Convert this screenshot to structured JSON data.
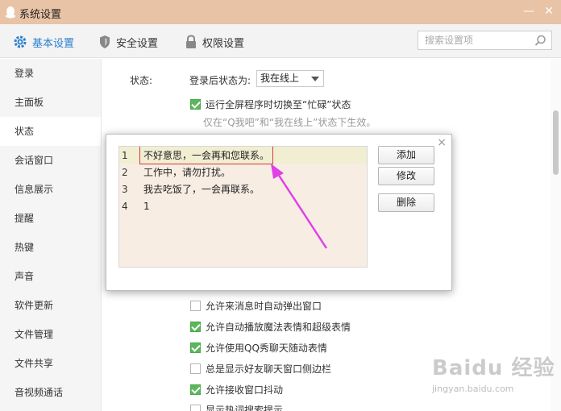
{
  "window": {
    "title": "系统设置",
    "minimize_glyph": "—",
    "close_glyph": "✕"
  },
  "topnav": {
    "tabs": [
      {
        "label": "基本设置",
        "icon": "gear-icon"
      },
      {
        "label": "安全设置",
        "icon": "shield-icon"
      },
      {
        "label": "权限设置",
        "icon": "lock-icon"
      }
    ],
    "search_placeholder": "搜索设置项"
  },
  "sidebar": {
    "items": [
      "登录",
      "主面板",
      "状态",
      "会话窗口",
      "信息展示",
      "提醒",
      "热键",
      "声音",
      "软件更新",
      "文件管理",
      "文件共享",
      "音视频通话"
    ],
    "active_index": 2
  },
  "status": {
    "section_label": "状态:",
    "after_login_label": "登录后状态为:",
    "after_login_value": "我在线上",
    "fullscreen_busy": "运行全屏程序时切换至“忙碌”状态",
    "hint": "仅在“Q我吧”和“我在线上”状态下生效。"
  },
  "options": [
    {
      "label": "允许来消息时自动弹出窗口",
      "checked": false
    },
    {
      "label": "允许自动播放魔法表情和超级表情",
      "checked": true
    },
    {
      "label": "允许使用QQ秀聊天随动表情",
      "checked": true
    },
    {
      "label": "总是显示好友聊天窗口侧边栏",
      "checked": false
    },
    {
      "label": "允许接收窗口抖动",
      "checked": true
    },
    {
      "label": "显示热词搜索提示",
      "checked": false
    }
  ],
  "dialog": {
    "close_glyph": "×",
    "replies": [
      {
        "num": "1",
        "text": "不好意思，一会再和您联系。"
      },
      {
        "num": "2",
        "text": "工作中，请勿打扰。"
      },
      {
        "num": "3",
        "text": "我去吃饭了，一会再联系。"
      },
      {
        "num": "4",
        "text": "1"
      }
    ],
    "add_label": "添加",
    "edit_label": "修改",
    "delete_label": "删除"
  },
  "watermark": {
    "brand": "Baidu 经验",
    "url": "jingyan.baidu.com"
  },
  "colors": {
    "titlebar": "#e8c3a6",
    "accent": "#2a7fd0",
    "check": "#5bb75b",
    "annotation_arrow": "#e040e8",
    "annotation_box": "#d9363e"
  }
}
